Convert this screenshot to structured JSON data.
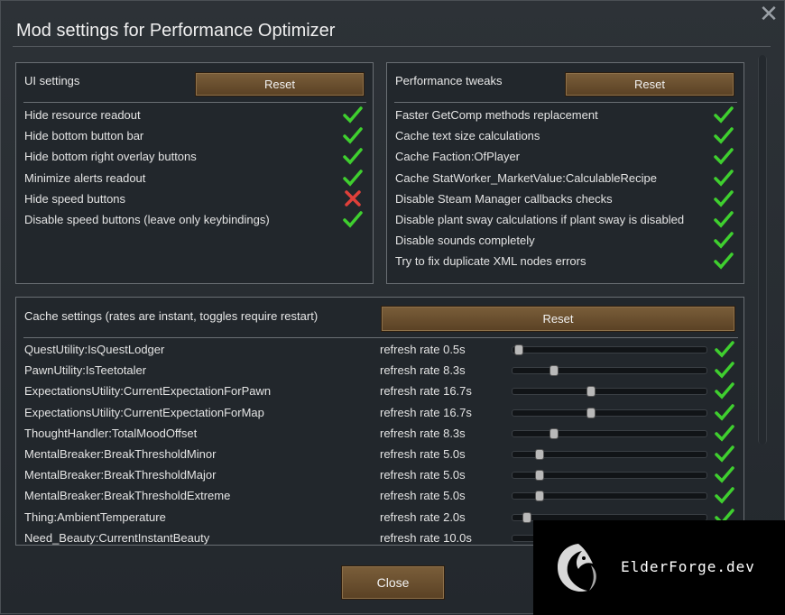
{
  "window": {
    "title": "Mod settings for Performance Optimizer",
    "close_glyph": "✕"
  },
  "ui_settings": {
    "title": "UI settings",
    "reset_label": "Reset",
    "items": [
      {
        "label": "Hide resource readout",
        "checked": true
      },
      {
        "label": "Hide bottom button bar",
        "checked": true
      },
      {
        "label": "Hide bottom right overlay buttons",
        "checked": true
      },
      {
        "label": "Minimize alerts readout",
        "checked": true
      },
      {
        "label": "Hide speed buttons",
        "checked": false
      },
      {
        "label": "Disable speed buttons (leave only keybindings)",
        "checked": true
      }
    ]
  },
  "performance_tweaks": {
    "title": "Performance tweaks",
    "reset_label": "Reset",
    "items": [
      {
        "label": "Faster GetComp methods replacement",
        "checked": true
      },
      {
        "label": "Cache text size calculations",
        "checked": true
      },
      {
        "label": "Cache Faction:OfPlayer",
        "checked": true
      },
      {
        "label": "Cache StatWorker_MarketValue:CalculableRecipe",
        "checked": true
      },
      {
        "label": "Disable Steam Manager callbacks checks",
        "checked": true
      },
      {
        "label": "Disable plant sway calculations if plant sway is disabled",
        "checked": true
      },
      {
        "label": "Disable sounds completely",
        "checked": true
      },
      {
        "label": "Try to fix duplicate XML nodes errors",
        "checked": true
      }
    ]
  },
  "cache_settings": {
    "title": "Cache settings (rates are instant, toggles require restart)",
    "reset_label": "Reset",
    "items": [
      {
        "label": "QuestUtility:IsQuestLodger",
        "rate": "refresh rate 0.5s",
        "level": 0.03,
        "checked": true
      },
      {
        "label": "PawnUtility:IsTeetotaler",
        "rate": "refresh rate 8.3s",
        "level": 0.21,
        "checked": true
      },
      {
        "label": "ExpectationsUtility:CurrentExpectationForPawn",
        "rate": "refresh rate 16.7s",
        "level": 0.4,
        "checked": true
      },
      {
        "label": "ExpectationsUtility:CurrentExpectationForMap",
        "rate": "refresh rate 16.7s",
        "level": 0.4,
        "checked": true
      },
      {
        "label": "ThoughtHandler:TotalMoodOffset",
        "rate": "refresh rate 8.3s",
        "level": 0.21,
        "checked": true
      },
      {
        "label": "MentalBreaker:BreakThresholdMinor",
        "rate": "refresh rate 5.0s",
        "level": 0.135,
        "checked": true
      },
      {
        "label": "MentalBreaker:BreakThresholdMajor",
        "rate": "refresh rate 5.0s",
        "level": 0.135,
        "checked": true
      },
      {
        "label": "MentalBreaker:BreakThresholdExtreme",
        "rate": "refresh rate 5.0s",
        "level": 0.135,
        "checked": true
      },
      {
        "label": "Thing:AmbientTemperature",
        "rate": "refresh rate 2.0s",
        "level": 0.07,
        "checked": true
      },
      {
        "label": "Need_Beauty:CurrentInstantBeauty",
        "rate": "refresh rate 10.0s",
        "level": 0.25,
        "checked": true
      }
    ]
  },
  "footer": {
    "close_label": "Close"
  },
  "watermark": {
    "text": "ElderForge.dev"
  },
  "colors": {
    "check": "#3fcf2f",
    "cross": "#e0403a",
    "button": "#6b5030"
  }
}
